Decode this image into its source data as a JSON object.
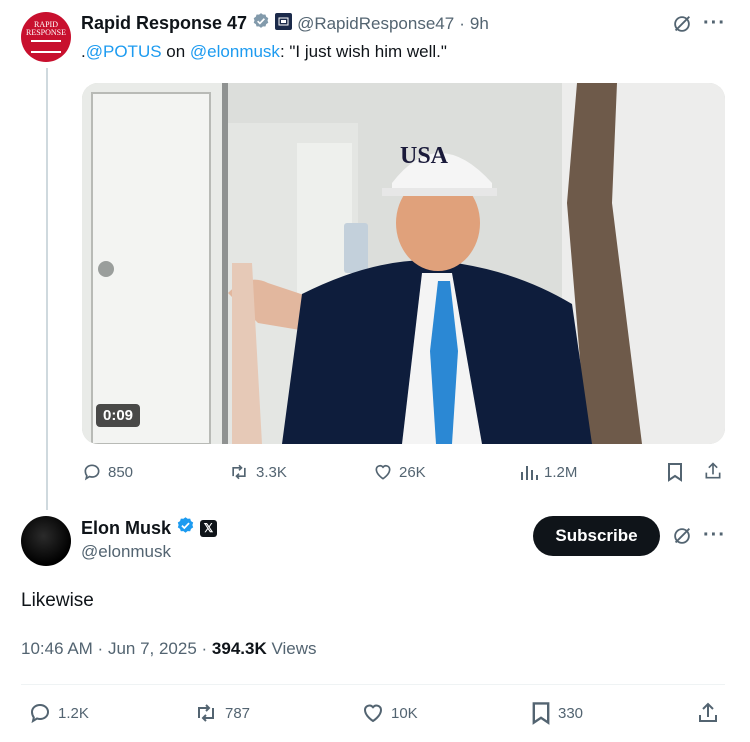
{
  "post1": {
    "avatar_text": [
      "RAPID",
      "RESPONSE"
    ],
    "name": "Rapid Response 47",
    "handle": "@RapidResponse47",
    "time": "9h",
    "text_prefix": ".",
    "mention1": "@POTUS",
    "text_mid": " on ",
    "mention2": "@elonmusk",
    "text_suffix": ": \"I just wish him well.\"",
    "video_duration": "0:09",
    "cap_text": "USA",
    "stats": {
      "replies": "850",
      "reposts": "3.3K",
      "likes": "26K",
      "views": "1.2M"
    }
  },
  "post2": {
    "name": "Elon Musk",
    "handle": "@elonmusk",
    "subscribe_label": "Subscribe",
    "text": "Likewise",
    "time": "10:46 AM",
    "date": "Jun 7, 2025",
    "views_count": "394.3K",
    "views_label": "Views",
    "stats": {
      "replies": "1.2K",
      "reposts": "787",
      "likes": "10K",
      "bookmarks": "330"
    }
  },
  "colors": {
    "link": "#1d9bf0",
    "verified": "#1d9bf0",
    "muted": "#536471",
    "text": "#0f1419",
    "brand_red": "#c8102e"
  },
  "icons": [
    "grok-icon",
    "more-icon",
    "reply-icon",
    "repost-icon",
    "like-icon",
    "views-icon",
    "bookmark-icon",
    "share-icon",
    "verified-icon",
    "x-logo-icon"
  ]
}
